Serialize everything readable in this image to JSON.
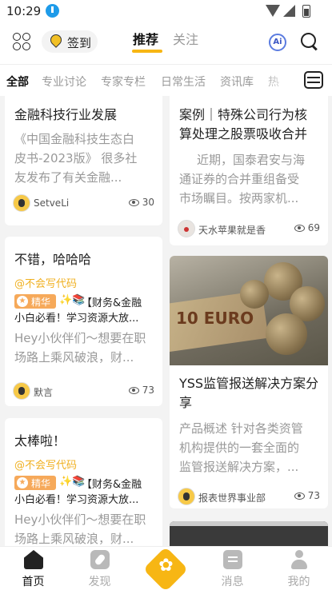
{
  "status_bar": {
    "time": "10:29"
  },
  "header": {
    "signin_label": "签到",
    "tabs": [
      {
        "label": "推荐"
      },
      {
        "label": "关注"
      }
    ],
    "ai_label": "Ai"
  },
  "categories": [
    "全部",
    "专业讨论",
    "专家专栏",
    "日常生活",
    "资讯库",
    "热"
  ],
  "feed": {
    "left": [
      {
        "title": "金融科技行业发展",
        "body_lines": [
          "《中国金融科技生态白",
          "皮书-2023版》 很多社",
          "友发布了有关金融..."
        ],
        "author": "SetveLi",
        "views": "30"
      },
      {
        "title": "不错，哈哈哈",
        "mention": "@不会写代码",
        "badge": "精华",
        "quote_line": "【财务&金融",
        "body_lines": [
          "小白必看！学习资源大放...",
          "Hey小伙伴们～想要在职",
          "场路上乘风破浪，财..."
        ],
        "author": "默言",
        "views": "73"
      },
      {
        "title": "太棒啦！",
        "mention": "@不会写代码",
        "badge": "精华",
        "quote_line": "【财务&金融",
        "body_lines": [
          "小白必看！学习资源大放...",
          "Hey小伙伴们～想要在职",
          "场路上乘风破浪，财..."
        ]
      }
    ],
    "right": [
      {
        "title_lines": [
          "案例｜特殊公司行为核",
          "算处理之股票吸收合并"
        ],
        "body_lines": [
          "近期，国泰君安与海",
          "通证券的合并重组备受",
          "市场瞩目。按两家机..."
        ],
        "author": "天水苹果就是香",
        "views": "69"
      },
      {
        "image_text": "10 EURO",
        "title_lines": [
          "YSS监管报送解决方案分",
          "享"
        ],
        "body_lines": [
          "产品概述 针对各类资管",
          "机构提供的一套全面的",
          "监管报送解决方案，..."
        ],
        "author": "报表世界事业部",
        "views": "73"
      }
    ]
  },
  "bottom_nav": [
    {
      "label": "首页"
    },
    {
      "label": "发现"
    },
    {
      "label": "消息"
    },
    {
      "label": "我的"
    }
  ]
}
